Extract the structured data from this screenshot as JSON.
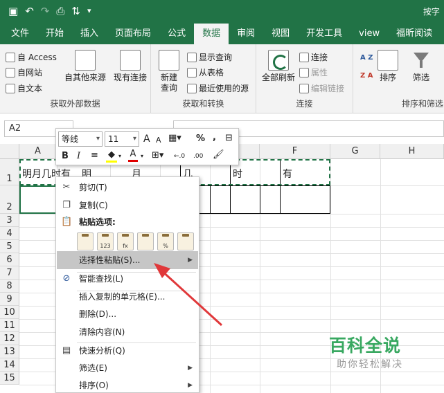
{
  "titlebar": {
    "title": "按字",
    "undo": "↶",
    "redo": "↷"
  },
  "tabs": [
    "文件",
    "开始",
    "插入",
    "页面布局",
    "公式",
    "数据",
    "审阅",
    "视图",
    "开发工具",
    "view",
    "福昕阅读"
  ],
  "ribbon": {
    "get_external": {
      "access": "自 Access",
      "web": "自网站",
      "text": "自文本",
      "other": "自其他来源",
      "existing": "现有连接",
      "label": "获取外部数据"
    },
    "get_transform": {
      "new_query_1": "新建",
      "new_query_2": "查询",
      "show_queries": "显示查询",
      "from_table": "从表格",
      "recent_sources": "最近使用的源",
      "label": "获取和转换"
    },
    "connections": {
      "refresh_all": "全部刷新",
      "connections": "连接",
      "properties": "属性",
      "edit_links": "编辑链接",
      "label": "连接"
    },
    "sort_filter": {
      "sort": "排序",
      "filter": "筛选",
      "label": "排序和筛选",
      "az": "A Z",
      "za": "Z A"
    }
  },
  "formula_bar": {
    "name_box": "A2"
  },
  "columns": [
    "A",
    "B",
    "C",
    "D",
    "E",
    "F",
    "G",
    "H"
  ],
  "rows": [
    "1",
    "2",
    "3",
    "4",
    "5",
    "6",
    "7",
    "8",
    "9",
    "10",
    "11",
    "12",
    "13",
    "14",
    "15"
  ],
  "cells": {
    "A1": "明月几时有",
    "B1": "明",
    "C1": "月",
    "D1": "几",
    "E1": "时",
    "F1": "有"
  },
  "mini_toolbar": {
    "font_name": "等线",
    "font_size": "11",
    "grow": "A",
    "shrink": "A",
    "percent": "%",
    "comma": ",",
    "bold": "B",
    "italic": "I",
    "font_color": "A",
    "inc_decimal": "←.0",
    "dec_decimal": ".00"
  },
  "context_menu": {
    "cut": "剪切(T)",
    "copy": "复制(C)",
    "paste_options": "粘贴选项:",
    "paste_icons": [
      "",
      "123",
      "fx",
      "",
      "%",
      ""
    ],
    "paste_special": "选择性粘贴(S)...",
    "smart_lookup": "智能查找(L)",
    "insert_copied": "插入复制的单元格(E)...",
    "delete": "删除(D)...",
    "clear": "清除内容(N)",
    "quick_analysis": "快速分析(Q)",
    "filter": "筛选(E)",
    "sort": "排序(O)"
  },
  "watermark": {
    "line1": "百科全说",
    "line2": "助你轻松解决"
  },
  "colors": {
    "excel_green": "#217346",
    "arrow_red": "#e0383a"
  }
}
